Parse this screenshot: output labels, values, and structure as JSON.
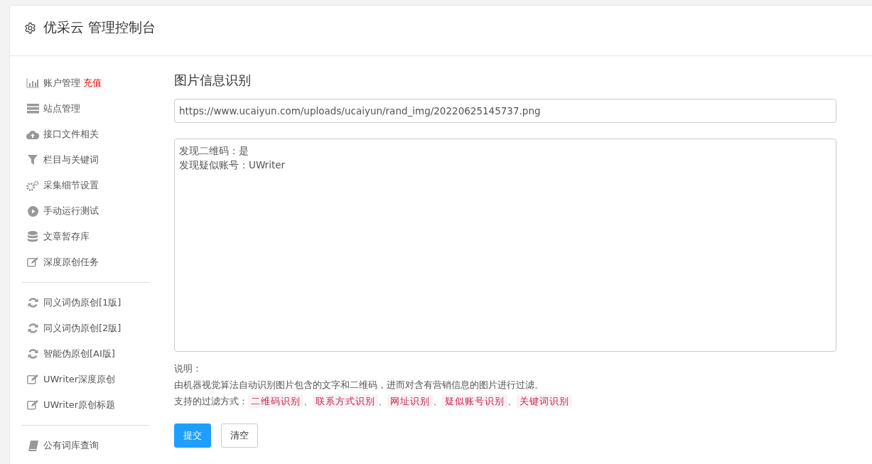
{
  "header": {
    "title": "优采云 管理控制台"
  },
  "sidebar": {
    "groups": [
      {
        "items": [
          {
            "label": "账户管理",
            "badge": "充值"
          },
          {
            "label": "站点管理"
          },
          {
            "label": "接口文件相关"
          },
          {
            "label": "栏目与关键词"
          },
          {
            "label": "采集细节设置"
          },
          {
            "label": "手动运行测试"
          },
          {
            "label": "文章暂存库"
          },
          {
            "label": "深度原创任务"
          }
        ]
      },
      {
        "items": [
          {
            "label": "同义词伪原创[1版]"
          },
          {
            "label": "同义词伪原创[2版]"
          },
          {
            "label": "智能伪原创[AI版]"
          },
          {
            "label": "UWriter深度原创"
          },
          {
            "label": "UWriter原创标题"
          }
        ]
      },
      {
        "items": [
          {
            "label": "公有词库查询"
          }
        ]
      }
    ]
  },
  "main": {
    "title": "图片信息识别",
    "url_field": {
      "value": "https://www.ucaiyun.com/uploads/ucaiyun/rand_img/20220625145737.png"
    },
    "result_box": {
      "lines": [
        "发现二维码：是",
        "发现疑似账号：UWriter"
      ]
    },
    "notes": {
      "heading": "说明：",
      "description": "由机器视觉算法自动识别图片包含的文字和二维码，进而对含有营销信息的图片进行过滤。",
      "filters_label": "支持的过滤方式：",
      "filters": [
        {
          "text": "二维码识别",
          "after": "、"
        },
        {
          "text": "联系方式识别",
          "after": "、"
        },
        {
          "text": "网址识别",
          "after": "、"
        },
        {
          "text": "疑似账号识别",
          "after": "、"
        },
        {
          "text": "关键词识别"
        }
      ]
    },
    "buttons": [
      {
        "label": "提交",
        "kind": "primary"
      },
      {
        "label": "清空",
        "kind": "default"
      }
    ]
  }
}
